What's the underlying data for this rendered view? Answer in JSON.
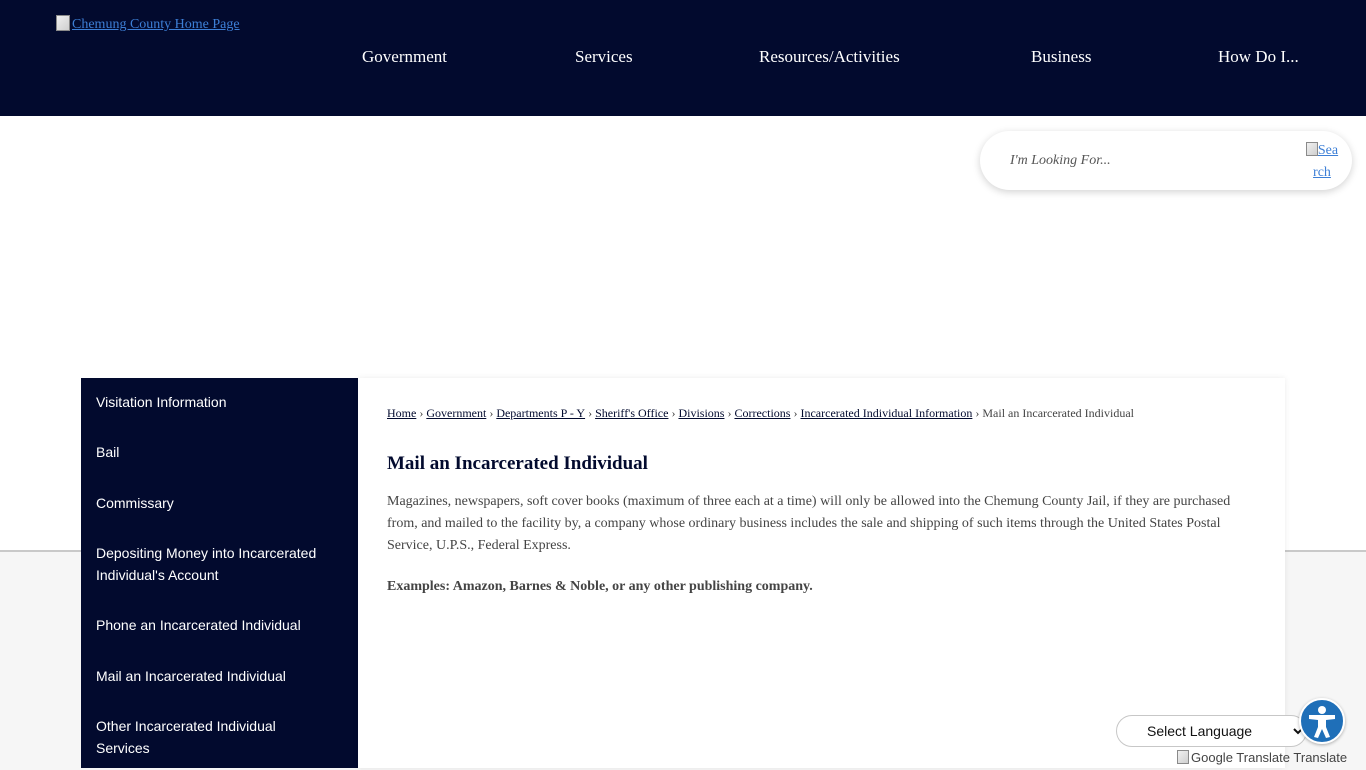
{
  "header": {
    "logo_alt": "Chemung County Home Page",
    "nav": [
      "Government",
      "Services",
      "Resources/Activities",
      "Business",
      "How Do I..."
    ]
  },
  "search": {
    "placeholder": "I'm Looking For...",
    "button_alt_line1": "Sea",
    "button_alt_line2": "rch"
  },
  "sidebar": {
    "items": [
      {
        "label": "Visitation Information"
      },
      {
        "label": "Bail"
      },
      {
        "label": "Commissary"
      },
      {
        "label": "Depositing Money into Incarcerated Individual's Account"
      },
      {
        "label": "Phone an Incarcerated Individual"
      },
      {
        "label": "Mail an Incarcerated Individual"
      },
      {
        "label": "Other Incarcerated Individual Services"
      }
    ]
  },
  "breadcrumb": {
    "links": [
      "Home",
      "Government",
      "Departments P - Y",
      "Sheriff's Office",
      "Divisions",
      "Corrections",
      "Incarcerated Individual Information"
    ],
    "current": "Mail an Incarcerated Individual",
    "separator": "›"
  },
  "main": {
    "title": "Mail an Incarcerated Individual",
    "paragraph": "Magazines, newspapers, soft cover books (maximum of three each at a time) will only be allowed into the Chemung County Jail, if they are purchased from, and mailed to the facility by, a company whose ordinary business includes the sale and shipping of such items through the United States Postal Service, U.P.S., Federal Express.",
    "examples": "Examples: Amazon, Barnes & Noble, or any other publishing company."
  },
  "translate": {
    "select_label": "Select Language",
    "google_alt": "Google Translate",
    "translate_label": "Translate"
  },
  "accessibility": {
    "icon": "accessibility-icon"
  }
}
